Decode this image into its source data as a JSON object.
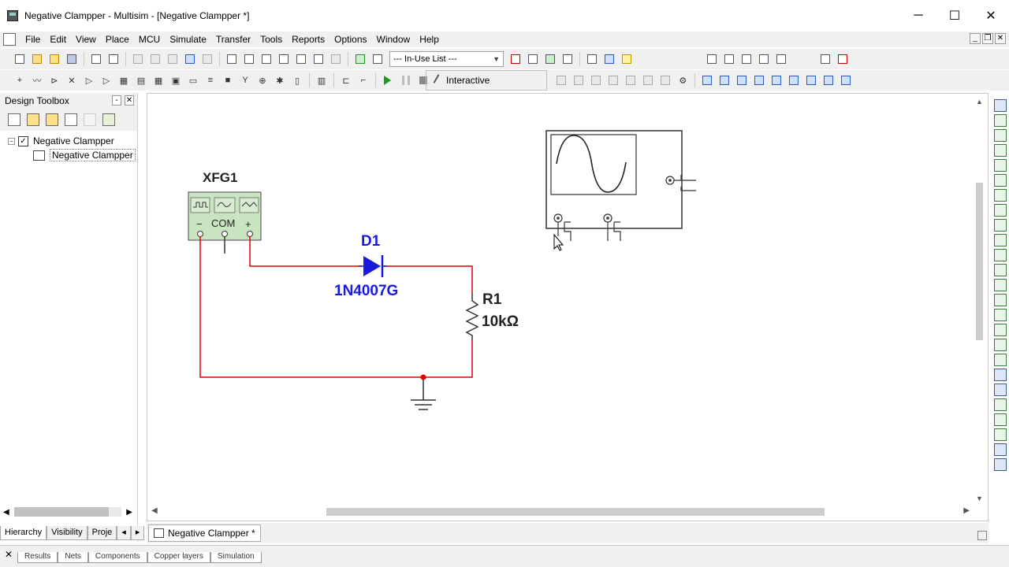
{
  "window": {
    "title": "Negative Clampper - Multisim - [Negative Clampper *]",
    "minimize": "─",
    "maximize": "☐",
    "close": "✕"
  },
  "menu": [
    {
      "label": "File"
    },
    {
      "label": "Edit"
    },
    {
      "label": "View"
    },
    {
      "label": "Place"
    },
    {
      "label": "MCU"
    },
    {
      "label": "Simulate"
    },
    {
      "label": "Transfer"
    },
    {
      "label": "Tools"
    },
    {
      "label": "Reports"
    },
    {
      "label": "Options"
    },
    {
      "label": "Window"
    },
    {
      "label": "Help"
    }
  ],
  "mdi": {
    "minimize": "_",
    "restore": "❐",
    "close": "✕"
  },
  "toolbar": {
    "in_use_list": "--- In-Use List ---",
    "interactive_label": "Interactive"
  },
  "toolbox": {
    "title": "Design Toolbox",
    "pin": "-",
    "close": "✕",
    "tree": {
      "project": "Negative Clampper",
      "sheet": "Negative Clampper",
      "checked": "✓",
      "collapse": "−"
    },
    "tabs": [
      "Hierarchy",
      "Visibility",
      "Proje"
    ]
  },
  "document": {
    "tab_label": "Negative Clampper *"
  },
  "schematic": {
    "generator": {
      "ref": "XFG1",
      "com": "COM",
      "minus": "−",
      "plus": "+"
    },
    "diode": {
      "ref": "D1",
      "part": "1N4007G"
    },
    "resistor": {
      "ref": "R1",
      "value": "10kΩ"
    },
    "colors": {
      "wire": "#e00000",
      "diode": "#1a1adc",
      "instrument_fill": "#c8e4c0",
      "junction": "#e00000"
    }
  },
  "results": {
    "close": "✕",
    "tabs": [
      "Results",
      "Nets",
      "Components",
      "Copper layers",
      "Simulation"
    ]
  }
}
